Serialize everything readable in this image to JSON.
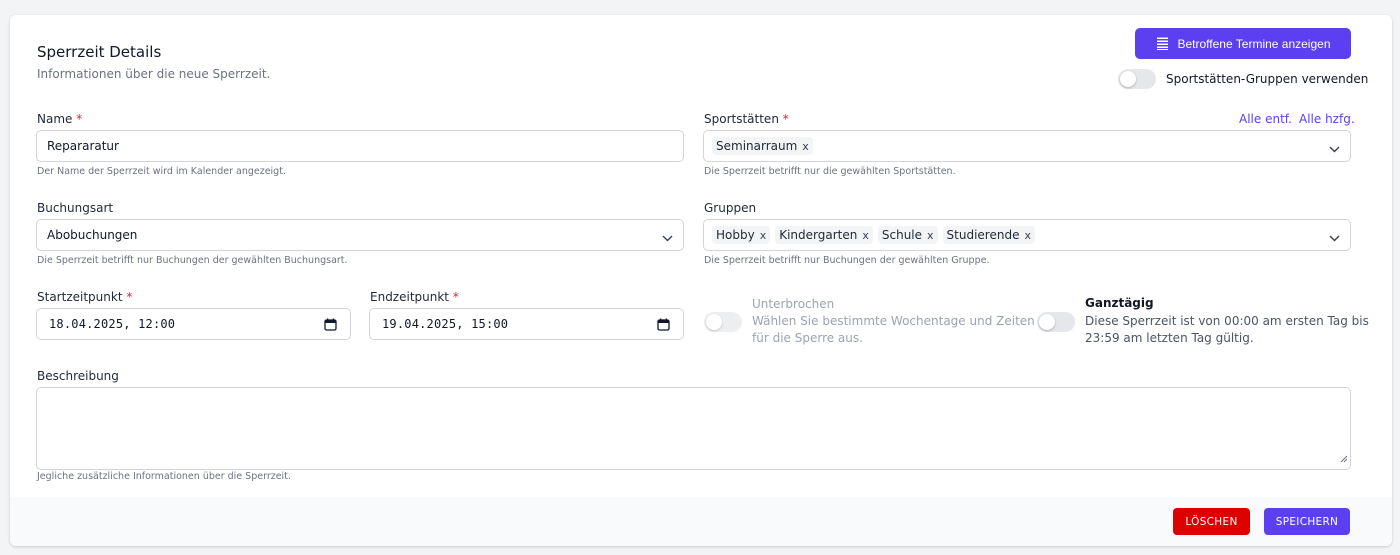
{
  "header": {
    "title": "Sperrzeit Details",
    "subtitle": "Informationen über die neue Sperrzeit.",
    "show_affected_label": "Betroffene Termine anzeigen",
    "group_toggle_label": "Sportstätten-Gruppen verwenden"
  },
  "name": {
    "label": "Name",
    "required": "*",
    "value": "Repararatur",
    "help": "Der Name der Sperrzeit wird im Kalender angezeigt."
  },
  "sportstaetten": {
    "label": "Sportstätten",
    "required": "*",
    "remove_all": "Alle entf.",
    "add_all": "Alle hzfg.",
    "chips": [
      {
        "label": "Seminarraum",
        "remove": "x"
      }
    ],
    "help": "Die Sperrzeit betrifft nur die gewählten Sportstätten."
  },
  "buchungsart": {
    "label": "Buchungsart",
    "value": "Abobuchungen",
    "help": "Die Sperrzeit betrifft nur Buchungen der gewählten Buchungsart."
  },
  "gruppen": {
    "label": "Gruppen",
    "chips": [
      {
        "label": "Hobby",
        "remove": "x"
      },
      {
        "label": "Kindergarten",
        "remove": "x"
      },
      {
        "label": "Schule",
        "remove": "x"
      },
      {
        "label": "Studierende",
        "remove": "x"
      }
    ],
    "help": "Die Sperrzeit betrifft nur Buchungen der gewählten Gruppe."
  },
  "start": {
    "label": "Startzeitpunkt",
    "required": "*",
    "value": "18.04.2025, 12:00"
  },
  "end": {
    "label": "Endzeitpunkt",
    "required": "*",
    "value": "19.04.2025, 15:00"
  },
  "unterbrochen": {
    "title": "Unterbrochen",
    "line1": "Wählen Sie bestimmte Wochentage und Zeiten",
    "line2": "für die Sperre aus."
  },
  "ganztaegig": {
    "title": "Ganztägig",
    "line1": "Diese Sperrzeit ist von 00:00 am ersten Tag bis",
    "line2": "23:59 am letzten Tag gültig."
  },
  "beschreibung": {
    "label": "Beschreibung",
    "value": "",
    "help": "Jegliche zusätzliche Informationen über die Sperrzeit."
  },
  "footer": {
    "delete_label": "LÖSCHEN",
    "save_label": "SPEICHERN"
  },
  "colors": {
    "accent": "#5b3ff0",
    "danger": "#dc0000",
    "required": "#dc2626"
  }
}
